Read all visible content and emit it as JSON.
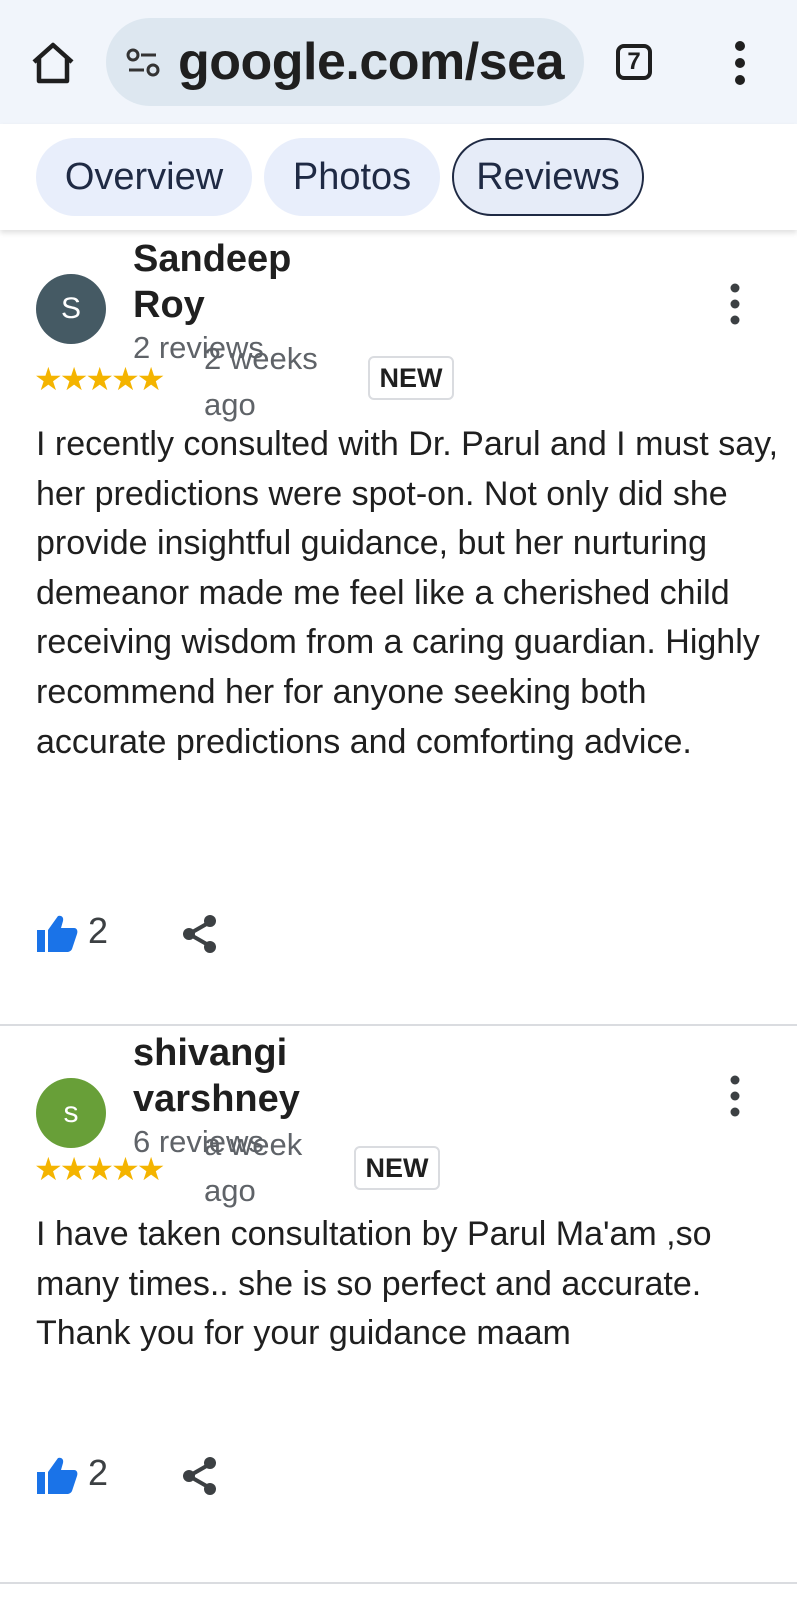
{
  "browser": {
    "url": "google.com/sea",
    "tab_count": "7"
  },
  "tabs": [
    {
      "label": "Overview"
    },
    {
      "label": "Photos"
    },
    {
      "label": "Reviews"
    }
  ],
  "reviews": [
    {
      "avatar_letter": "S",
      "avatar_color": "#455a64",
      "name": "Sandeep Roy",
      "review_count": "2 reviews",
      "rating": 5,
      "stars": "★★★★★",
      "time": "2 weeks ago",
      "badge": "NEW",
      "text": "I recently consulted with Dr. Parul and I must say, her predictions were spot-on. Not only did she provide insightful guidance, but her nurturing demeanor made me feel like a cherished child receiving wisdom from a caring guardian. Highly recommend her for anyone seeking both accurate predictions and comforting advice.",
      "likes": "2"
    },
    {
      "avatar_letter": "s",
      "avatar_color": "#689f38",
      "name": "shivangi varshney",
      "review_count": "6 reviews",
      "rating": 5,
      "stars": "★★★★★",
      "time": "a week ago",
      "badge": "NEW",
      "text": "I have taken consultation by Parul Ma'am ,so many times.. she is so perfect and accurate.\nThank you for your guidance maam",
      "likes": "2"
    }
  ],
  "colors": {
    "star": "#f4b400",
    "like_icon": "#1a73e8",
    "topbar_bg": "#f1f5fb",
    "chip_bg": "#e8eefb"
  }
}
